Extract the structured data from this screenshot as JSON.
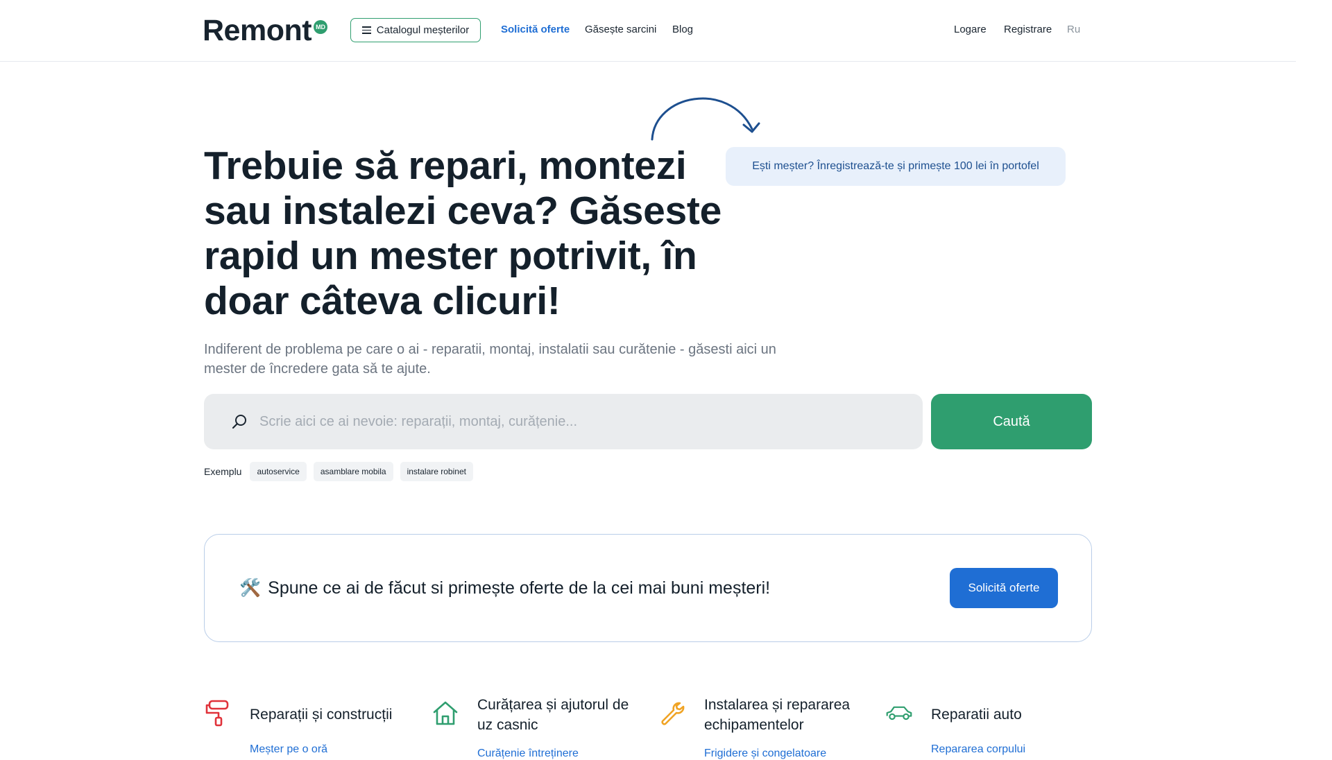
{
  "header": {
    "logo_text": "Remont",
    "logo_badge": "MD",
    "catalog_label": "Catalogul meșterilor",
    "nav": [
      "Solicită oferte",
      "Găsește sarcini",
      "Blog"
    ],
    "login": "Logare",
    "register": "Registrare",
    "lang": "Ru"
  },
  "hero": {
    "promo": "Ești meșter? Înregistrează-te și primește 100 lei în portofel",
    "title": "Trebuie să repari, montezi sau instalezi ceva? Găseste rapid un mester potrivit, în doar câteva clicuri!",
    "subtitle": "Indiferent de problema pe care o ai - reparatii, montaj, instalatii sau curătenie - găsesti aici un mester de încredere gata să te ajute."
  },
  "search": {
    "placeholder": "Scrie aici ce ai nevoie: reparații, montaj, curățenie...",
    "value": "",
    "button": "Caută"
  },
  "examples": {
    "label": "Exemplu",
    "items": [
      "autoservice",
      "asamblare mobila",
      "instalare robinet"
    ]
  },
  "cta": {
    "icon": "🛠️",
    "text": "Spune ce ai de făcut si primește oferte de la cei mai buni meșteri!",
    "button": "Solicită oferte"
  },
  "categories": [
    {
      "title": "Reparații și construcții",
      "link": "Meșter pe o oră",
      "icon": "paint-roller-icon",
      "color": "#e0323a"
    },
    {
      "title": "Curățarea și ajutorul de uz casnic",
      "link": "Curățenie întreținere",
      "icon": "house-icon",
      "color": "#2f9e6f"
    },
    {
      "title": "Instalarea și repararea echipamentelor",
      "link": "Frigidere și congelatoare",
      "icon": "wrench-icon",
      "color": "#f0a323"
    },
    {
      "title": "Reparatii auto",
      "link": "Repararea corpului",
      "icon": "car-icon",
      "color": "#2f9e6f"
    }
  ],
  "colors": {
    "brand_green": "#2f9e6f",
    "brand_blue": "#1f6ed4",
    "promo_bg": "#e8f0fb",
    "search_bg": "#eaecee"
  }
}
